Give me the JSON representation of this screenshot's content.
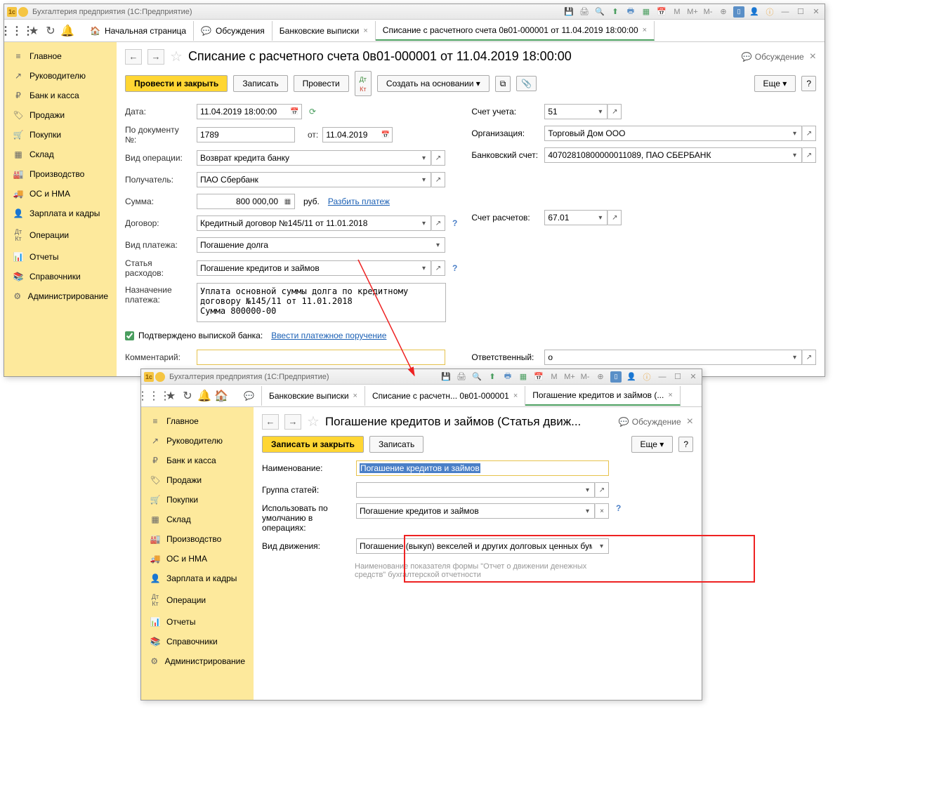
{
  "app_title": "Бухгалтерия предприятия  (1С:Предприятие)",
  "sidebar": {
    "items": [
      {
        "icon": "≡",
        "label": "Главное"
      },
      {
        "icon": "↗",
        "label": "Руководителю"
      },
      {
        "icon": "₽",
        "label": "Банк и касса"
      },
      {
        "icon": "🏷",
        "label": "Продажи"
      },
      {
        "icon": "🛒",
        "label": "Покупки"
      },
      {
        "icon": "▦",
        "label": "Склад"
      },
      {
        "icon": "📊",
        "label": "Производство"
      },
      {
        "icon": "🚚",
        "label": "ОС и НМА"
      },
      {
        "icon": "👤",
        "label": "Зарплата и кадры"
      },
      {
        "icon": "Дт",
        "label": "Операции"
      },
      {
        "icon": "📈",
        "label": "Отчеты"
      },
      {
        "icon": "📚",
        "label": "Справочники"
      },
      {
        "icon": "⚙",
        "label": "Администрирование"
      }
    ]
  },
  "tabs1": [
    {
      "icon": "🏠",
      "label": "Начальная страница"
    },
    {
      "icon": "💬",
      "label": "Обсуждения"
    },
    {
      "label": "Банковские выписки",
      "closable": true
    },
    {
      "label": "Списание с расчетного счета 0в01-000001 от 11.04.2019 18:00:00",
      "closable": true,
      "active": true
    }
  ],
  "page1": {
    "title": "Списание с расчетного счета 0в01-000001 от 11.04.2019 18:00:00",
    "discussion": "Обсуждение",
    "cmd": {
      "post_close": "Провести и закрыть",
      "save": "Записать",
      "post": "Провести",
      "create_based": "Создать на основании",
      "more": "Еще"
    },
    "labels": {
      "date": "Дата:",
      "docnum": "По документу №:",
      "from": "от:",
      "optype": "Вид операции:",
      "recipient": "Получатель:",
      "amount": "Сумма:",
      "currency": "руб.",
      "split": "Разбить платеж",
      "contract": "Договор:",
      "paytype": "Вид платежа:",
      "expense": "Статья расходов:",
      "purpose": "Назначение платежа:",
      "confirmed": "Подтверждено выпиской банка:",
      "enter_order": "Ввести платежное поручение",
      "comment": "Комментарий:",
      "account": "Счет учета:",
      "org": "Организация:",
      "bankacct": "Банковский счет:",
      "settle_acct": "Счет расчетов:",
      "responsible": "Ответственный:"
    },
    "values": {
      "date": "11.04.2019 18:00:00",
      "docnum": "1789",
      "docdate": "11.04.2019",
      "optype": "Возврат кредита банку",
      "recipient": "ПАО Сбербанк",
      "amount": "800 000,00",
      "contract": "Кредитный договор №145/11 от 11.01.2018",
      "paytype": "Погашение долга",
      "expense": "Погашение кредитов и займов",
      "purpose": "Уплата основной суммы долга по кредитному договору №145/11 от 11.01.2018\nСумма 800000-00",
      "comment": "",
      "account": "51",
      "org": "Торговый Дом ООО",
      "bankacct": "40702810800000011089, ПАО СБЕРБАНК",
      "settle_acct": "67.01",
      "responsible": "о"
    }
  },
  "tabs2": [
    {
      "label": "Банковские выписки",
      "closable": true
    },
    {
      "label": "Списание с расчетн... 0в01-000001",
      "closable": true
    },
    {
      "label": "Погашение кредитов и займов (...",
      "closable": true,
      "active": true
    }
  ],
  "page2": {
    "title": "Погашение кредитов и займов (Статья движ...",
    "discussion": "Обсуждение",
    "cmd": {
      "save_close": "Записать и закрыть",
      "save": "Записать",
      "more": "Еще"
    },
    "labels": {
      "name": "Наименование:",
      "group": "Группа статей:",
      "use_default": "Использовать по умолчанию в операциях:",
      "movement": "Вид движения:"
    },
    "values": {
      "name": "Погашение кредитов и займов",
      "group": "",
      "use_default": "Погашение кредитов и займов",
      "movement": "Погашение (выкуп) векселей и других долговых ценных бумаг,"
    },
    "hint": "Наименование показателя формы \"Отчет о движении денежных средств\" бухгалтерской отчетности"
  }
}
